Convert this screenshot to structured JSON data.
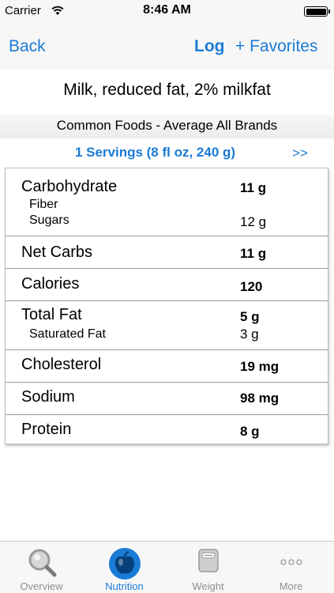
{
  "status_bar": {
    "carrier": "Carrier",
    "time": "8:46 AM"
  },
  "nav": {
    "back": "Back",
    "log": "Log",
    "favorites": "+ Favorites"
  },
  "food": {
    "name": "Milk, reduced fat, 2% milkfat",
    "source": "Common Foods - Average All Brands",
    "serving": "1 Servings (8 fl oz, 240 g)",
    "next": ">>"
  },
  "nutrition": {
    "carbohydrate": {
      "label": "Carbohydrate",
      "value": "11 g"
    },
    "fiber": {
      "label": "Fiber",
      "value": ""
    },
    "sugars": {
      "label": "Sugars",
      "value": "12 g"
    },
    "net_carbs": {
      "label": "Net Carbs",
      "value": "11 g"
    },
    "calories": {
      "label": "Calories",
      "value": "120"
    },
    "total_fat": {
      "label": "Total Fat",
      "value": "5 g"
    },
    "saturated_fat": {
      "label": "Saturated Fat",
      "value": "3 g"
    },
    "cholesterol": {
      "label": "Cholesterol",
      "value": "19 mg"
    },
    "sodium": {
      "label": "Sodium",
      "value": "98 mg"
    },
    "protein": {
      "label": "Protein",
      "value": "8 g"
    }
  },
  "tabs": [
    {
      "label": "Overview",
      "icon": "magnifier-icon",
      "active": false
    },
    {
      "label": "Nutrition",
      "icon": "apple-icon",
      "active": true
    },
    {
      "label": "Weight",
      "icon": "scale-icon",
      "active": false
    },
    {
      "label": "More",
      "icon": "more-dots-icon",
      "active": false
    }
  ],
  "colors": {
    "accent": "#1a7bd6",
    "bar_background": "#f7f7f7",
    "inactive_tab": "#8e8e8e"
  }
}
